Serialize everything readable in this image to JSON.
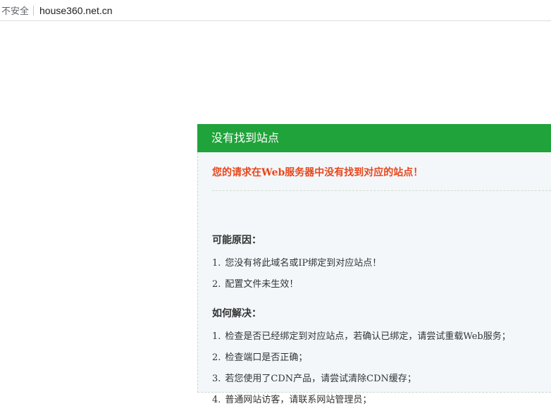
{
  "browser": {
    "security_label": "不安全",
    "url": "house360.net.cn"
  },
  "card": {
    "header_title": "没有找到站点",
    "error_message": "您的请求在Web服务器中没有找到对应的站点！",
    "reasons_title": "可能原因：",
    "reasons": [
      {
        "num": "1.",
        "text": "您没有将此域名或IP绑定到对应站点！"
      },
      {
        "num": "2.",
        "text": "配置文件未生效！"
      }
    ],
    "solutions_title": "如何解决：",
    "solutions": [
      {
        "num": "1.",
        "text": "检查是否已经绑定到对应站点，若确认已绑定，请尝试重载Web服务；"
      },
      {
        "num": "2.",
        "text": "检查端口是否正确；"
      },
      {
        "num": "3.",
        "text": "若您使用了CDN产品，请尝试清除CDN缓存；"
      },
      {
        "num": "4.",
        "text": "普通网站访客，请联系网站管理员；"
      }
    ],
    "colors": {
      "header_bg": "#1fa33a",
      "error_text": "#e8461b",
      "body_bg": "#f3f7fa"
    }
  }
}
